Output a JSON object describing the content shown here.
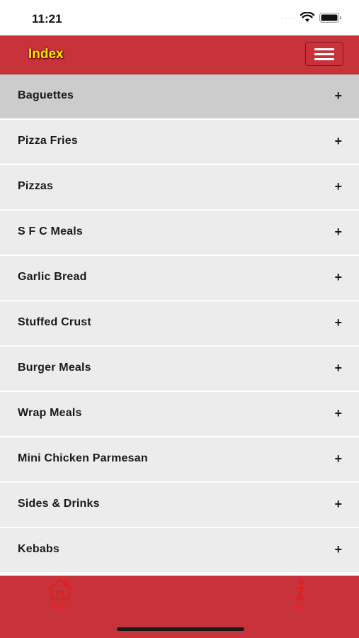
{
  "status": {
    "time": "11:21",
    "signal": "····"
  },
  "header": {
    "title": "Index"
  },
  "menu": {
    "items": [
      {
        "label": "Baguettes",
        "toggle": "+"
      },
      {
        "label": "Pizza Fries",
        "toggle": "+"
      },
      {
        "label": "Pizzas",
        "toggle": "+"
      },
      {
        "label": "S F C Meals",
        "toggle": "+"
      },
      {
        "label": "Garlic Bread",
        "toggle": "+"
      },
      {
        "label": "Stuffed Crust",
        "toggle": "+"
      },
      {
        "label": "Burger Meals",
        "toggle": "+"
      },
      {
        "label": "Wrap Meals",
        "toggle": "+"
      },
      {
        "label": "Mini Chicken Parmesan",
        "toggle": "+"
      },
      {
        "label": "Sides & Drinks",
        "toggle": "+"
      },
      {
        "label": "Kebabs",
        "toggle": "+"
      }
    ]
  },
  "bottom_nav": {
    "home_label": "Home",
    "info_label": "Info",
    "home_icon": "home-icon",
    "info_icon": "info-icon"
  },
  "colors": {
    "brand_red": "#c8323b",
    "title_yellow": "#ffe600",
    "row_bg": "#ececec",
    "row_active_bg": "#cccccc"
  }
}
